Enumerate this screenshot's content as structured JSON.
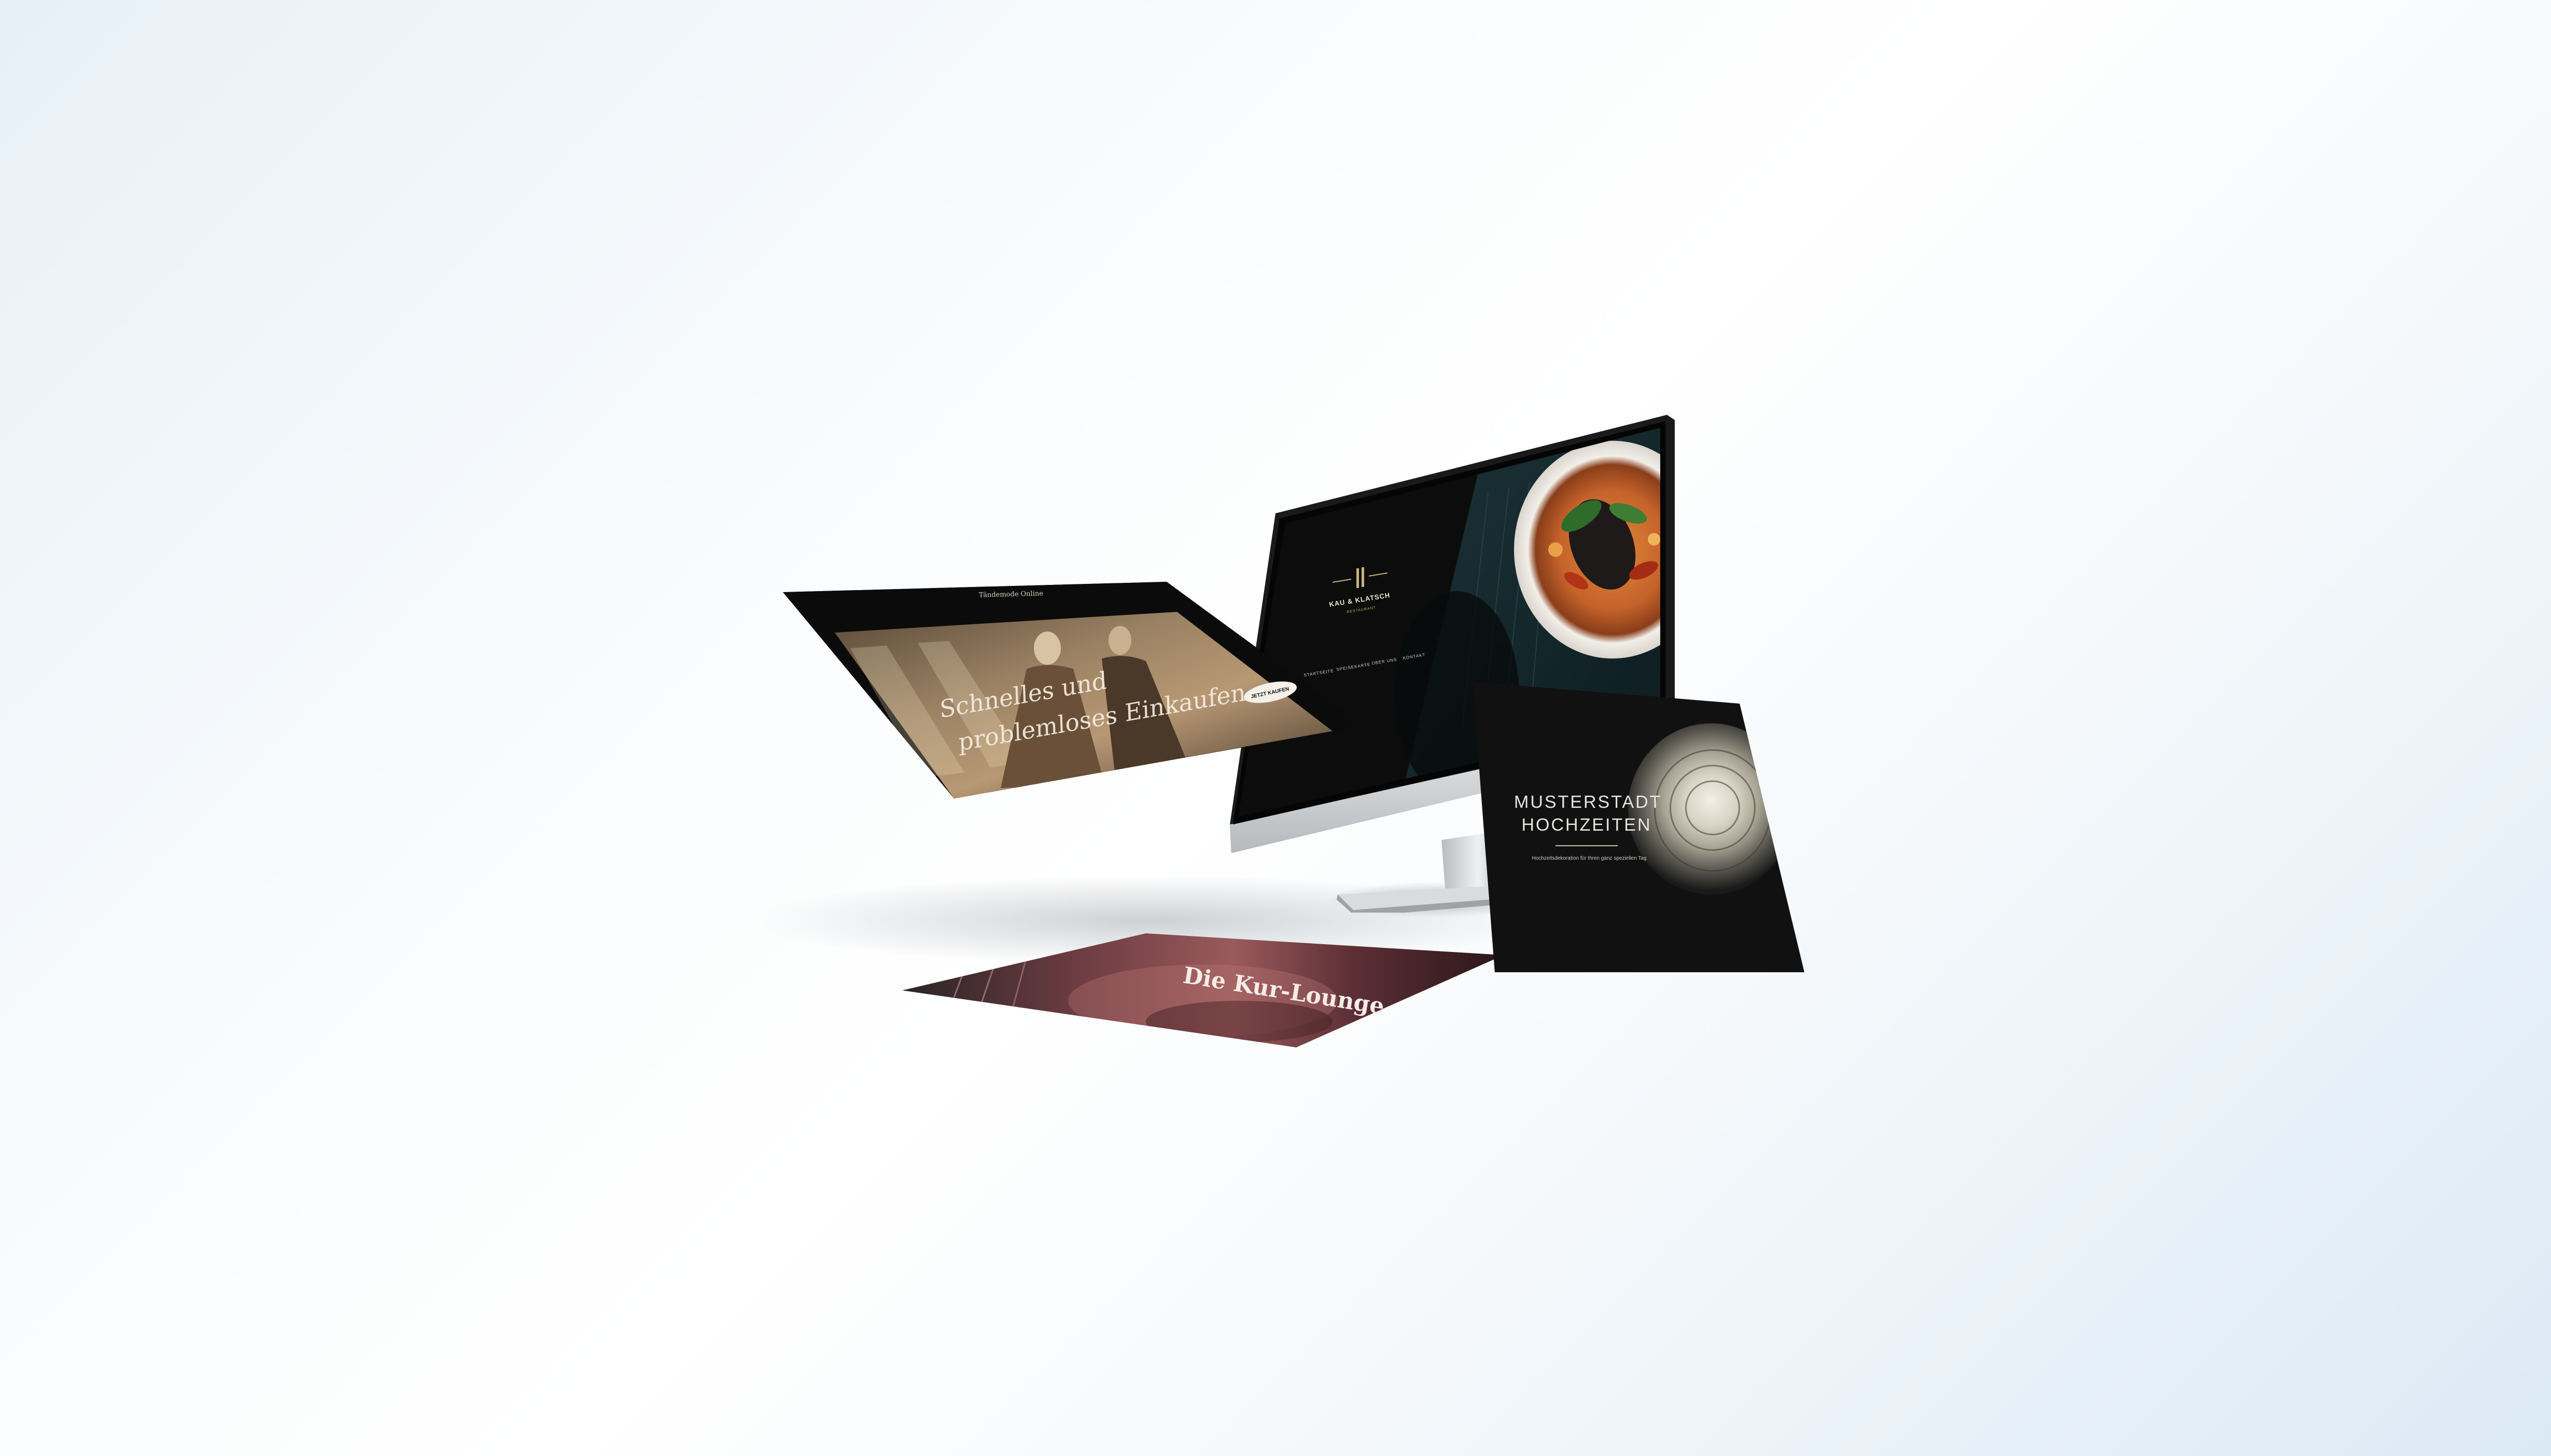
{
  "fashion_site": {
    "header_title": "Tändemode Online",
    "headline_line1": "Schnelles und",
    "headline_line2": "problemloses Einkaufen",
    "cta_label": "JETZT KAUFEN"
  },
  "restaurant_site": {
    "brand": "KAU & KLATSCH",
    "tagline": "RESTAURANT",
    "nav_items": [
      "STARTSEITE",
      "SPEISEKARTE",
      "ÜBER UNS",
      "KONTAKT"
    ]
  },
  "wedding_site": {
    "title": "MUSTERSTADT\nHOCHZEITEN",
    "subtitle": "Hochzeitsdekoration für Ihren ganz speziellen Tag"
  },
  "lounge_site": {
    "headline": "Die Kur-Lounge"
  },
  "colors": {
    "background_light": "#f8fbfd",
    "background_blue": "#dbe9f5",
    "screen_dark": "#0c0c0c",
    "accent_gold": "#c9b27a",
    "curry_orange": "#d07a2a"
  }
}
